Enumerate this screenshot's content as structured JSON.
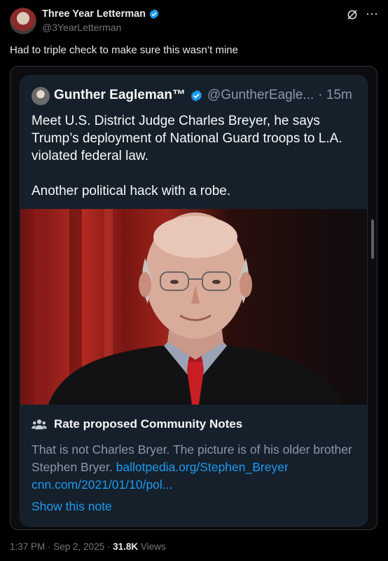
{
  "author": {
    "display_name": "Three Year Letterman",
    "handle": "@3YearLetterman"
  },
  "icons": {
    "verified": "verified-badge-icon",
    "grok": "grok-icon",
    "more": "more-icon",
    "community": "people-icon"
  },
  "tweet": {
    "text": "Had to triple check to make sure this wasn’t mine"
  },
  "quoted": {
    "display_name": "Gunther Eagleman™",
    "handle": "@GuntherEagle...",
    "time": "· 15m",
    "text": "Meet U.S. District Judge Charles Breyer, he says Trump’s deployment of National Guard troops to L.A. violated federal law.\n\nAnother political hack with a robe."
  },
  "community_note": {
    "title": "Rate proposed Community Notes",
    "body": "That is not Charles Bryer. The picture is of his older brother Stephen Bryer. ",
    "link1": "ballotpedia.org/Stephen_Breyer",
    "link2": "cnn.com/2021/01/10/pol...",
    "show_label": "Show this note"
  },
  "footer": {
    "time": "1:37 PM · Sep 2, 2025 · ",
    "views_count": "31.8K",
    "views_label": " Views"
  },
  "colors": {
    "background": "#000000",
    "card": "#15202b",
    "link": "#1d9bf0",
    "verified": "#1d9bf0"
  }
}
